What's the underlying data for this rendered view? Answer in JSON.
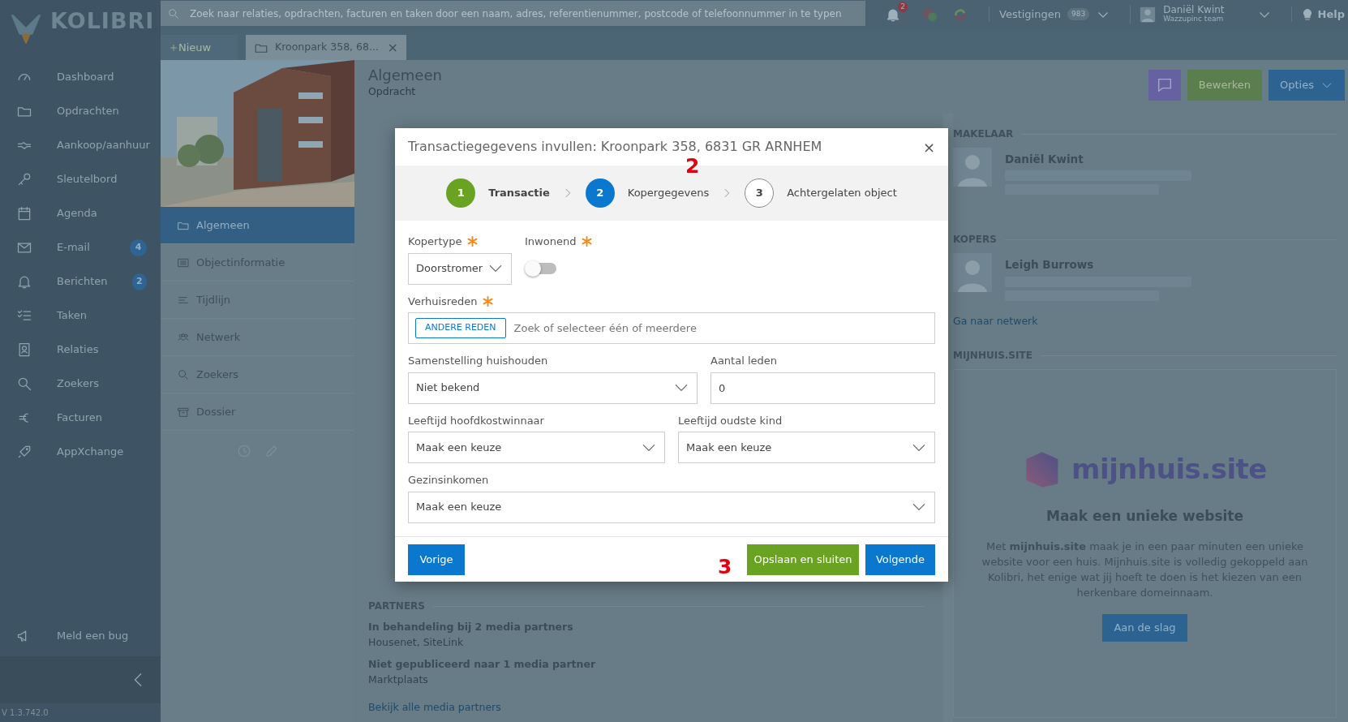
{
  "app": {
    "logo": "KOLIBRI",
    "version": "V 1.3.742.0"
  },
  "search": {
    "placeholder": "Zoek naar relaties, opdrachten, facturen en taken door een naam, adres, referentienummer, postcode of telefoonnummer in te typen"
  },
  "topbar": {
    "notifications": "2",
    "branches_label": "Vestigingen",
    "branches_count": "983",
    "user_name": "Daniël Kwint",
    "user_team": "Wazzupinc team",
    "help": "Help"
  },
  "sidebar": {
    "items": [
      {
        "label": "Dashboard"
      },
      {
        "label": "Opdrachten"
      },
      {
        "label": "Aankoop/aanhuur"
      },
      {
        "label": "Sleutelbord"
      },
      {
        "label": "Agenda"
      },
      {
        "label": "E-mail",
        "badge": "4"
      },
      {
        "label": "Berichten",
        "badge": "2"
      },
      {
        "label": "Taken"
      },
      {
        "label": "Relaties"
      },
      {
        "label": "Zoekers"
      },
      {
        "label": "Facturen"
      },
      {
        "label": "AppXchange"
      }
    ],
    "bottom_item": "Meld een bug"
  },
  "tabs": [
    {
      "label": "Nieuw",
      "kind": "new",
      "selected": false
    },
    {
      "label": "Kroonpark 358, 68...",
      "kind": "document",
      "selected": true,
      "close": "×"
    }
  ],
  "object_nav": {
    "items": [
      {
        "label": "Algemeen",
        "selected": true
      },
      {
        "label": "Objectinformatie",
        "selected": false
      },
      {
        "label": "Tijdlijn",
        "selected": false
      },
      {
        "label": "Netwerk",
        "selected": false
      },
      {
        "label": "Zoekers",
        "selected": false
      },
      {
        "label": "Dossier",
        "selected": false
      }
    ]
  },
  "header": {
    "title": "Algemeen",
    "subtitle": "Opdracht",
    "edit_button": "Bewerken",
    "options_button": "Opties"
  },
  "partners": {
    "title": "PARTNERS",
    "groups": [
      {
        "title": "In behandeling bij 2 media partners",
        "names": "Housenet,  SiteLink"
      },
      {
        "title": "Niet gepubliceerd naar 1 media partner",
        "names": "Marktplaats"
      }
    ],
    "link": "Bekijk alle media partners"
  },
  "right_panel": {
    "makelaar": {
      "title": "MAKELAAR",
      "name": "Daniël Kwint"
    },
    "kopers": {
      "title": "KOPERS",
      "name": "Leigh Burrows",
      "link": "Ga naar netwerk"
    },
    "mijnhuis": {
      "title": "MIJNHUIS.SITE",
      "logo": "mijnhuis.site",
      "heading": "Maak een unieke website",
      "text": "Met **mijnhuis.site** maak je in een paar minuten een unieke website voor een huis. Mijnhuis.site is volledig gekoppeld aan Kolibri, het enige wat jij hoeft te doen is het kiezen van een herkenbare domeinnaam.",
      "button": "Aan de slag"
    }
  },
  "modal": {
    "title": "Transactiegegevens invullen: Kroonpark 358, 6831 GR ARNHEM",
    "close": "×",
    "steps": [
      {
        "number": "1",
        "label": "Transactie",
        "completed": true,
        "selected": false
      },
      {
        "number": "2",
        "label": "Kopergegevens",
        "completed": false,
        "selected": true
      },
      {
        "number": "3",
        "label": "Achtergelaten object",
        "completed": false,
        "selected": false
      }
    ],
    "rows": [
      [
        {
          "kind": "select",
          "label": "Kopertype",
          "required": true,
          "value": "Doorstromer"
        },
        {
          "kind": "toggle",
          "label": "Inwonend",
          "required": true,
          "on": false
        }
      ],
      [
        {
          "kind": "tags",
          "label": "Verhuisreden",
          "required": true,
          "tag": "ANDERE REDEN",
          "placeholder": "Zoek of selecteer één of meerdere"
        }
      ],
      [
        {
          "kind": "select",
          "label": "Samenstelling huishouden",
          "required": false,
          "value": "Niet bekend"
        },
        {
          "kind": "input",
          "label": "Aantal leden",
          "required": false,
          "value": "0"
        }
      ],
      [
        {
          "kind": "select",
          "label": "Leeftijd hoofdkostwinnaar",
          "required": false,
          "value": "Maak een keuze"
        },
        {
          "kind": "select",
          "label": "Leeftijd oudste kind",
          "required": false,
          "value": "Maak een keuze"
        }
      ],
      [
        {
          "kind": "select",
          "label": "Gezinsinkomen",
          "required": false,
          "value": "Maak een keuze"
        }
      ]
    ],
    "previous_button": "Vorige",
    "save_button": "Opslaan en sluiten",
    "next_button": "Volgende"
  },
  "annotations": [
    {
      "text": "2"
    },
    {
      "text": "3"
    }
  ]
}
